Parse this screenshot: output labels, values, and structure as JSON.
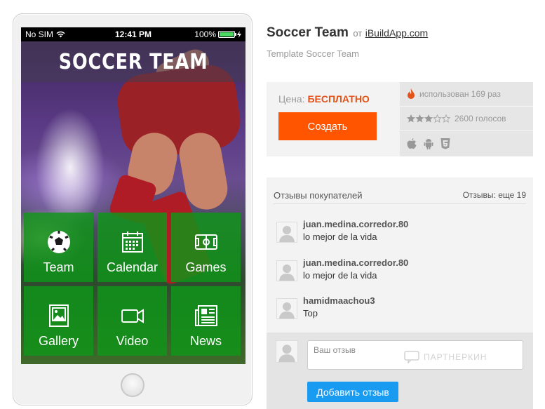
{
  "phone": {
    "status": {
      "carrier": "No SIM",
      "time": "12:41 PM",
      "battery": "100%"
    },
    "app_title": "SOCCER TEAM",
    "tiles": [
      {
        "label": "Team",
        "icon": "soccer-ball-icon"
      },
      {
        "label": "Calendar",
        "icon": "calendar-icon"
      },
      {
        "label": "Games",
        "icon": "field-icon"
      },
      {
        "label": "Gallery",
        "icon": "gallery-icon"
      },
      {
        "label": "Video",
        "icon": "video-camera-icon"
      },
      {
        "label": "News",
        "icon": "newspaper-icon"
      }
    ],
    "colors": {
      "tile": "#0f9619",
      "status_bar": "#000000"
    }
  },
  "details": {
    "name": "Soccer Team",
    "from_label": "от",
    "author": "iBuildApp.com",
    "subtitle": "Template Soccer Team"
  },
  "pricing": {
    "price_label": "Цена:",
    "price_value": "БЕСПЛАТНО",
    "create_button": "Создать",
    "used": "использован 169 раз",
    "votes": "2600 голосов",
    "rating_stars": 3,
    "rating_max": 5,
    "platforms": [
      "apple-icon",
      "android-icon",
      "html5-icon"
    ],
    "colors": {
      "accent": "#ff5500",
      "price": "#e4521a"
    }
  },
  "reviews": {
    "header": "Отзывы покупателей",
    "more": "Отзывы: еще 19",
    "items": [
      {
        "user": "juan.medina.corredor.80",
        "text": "lo mejor de la vida"
      },
      {
        "user": "juan.medina.corredor.80",
        "text": "lo mejor de la vida"
      },
      {
        "user": "hamidmaachou3",
        "text": "Top"
      }
    ],
    "compose": {
      "placeholder": "Ваш отзыв",
      "watermark": "ПАРТНЕРКИН",
      "submit": "Добавить отзыв"
    },
    "colors": {
      "submit": "#189bf0"
    }
  }
}
